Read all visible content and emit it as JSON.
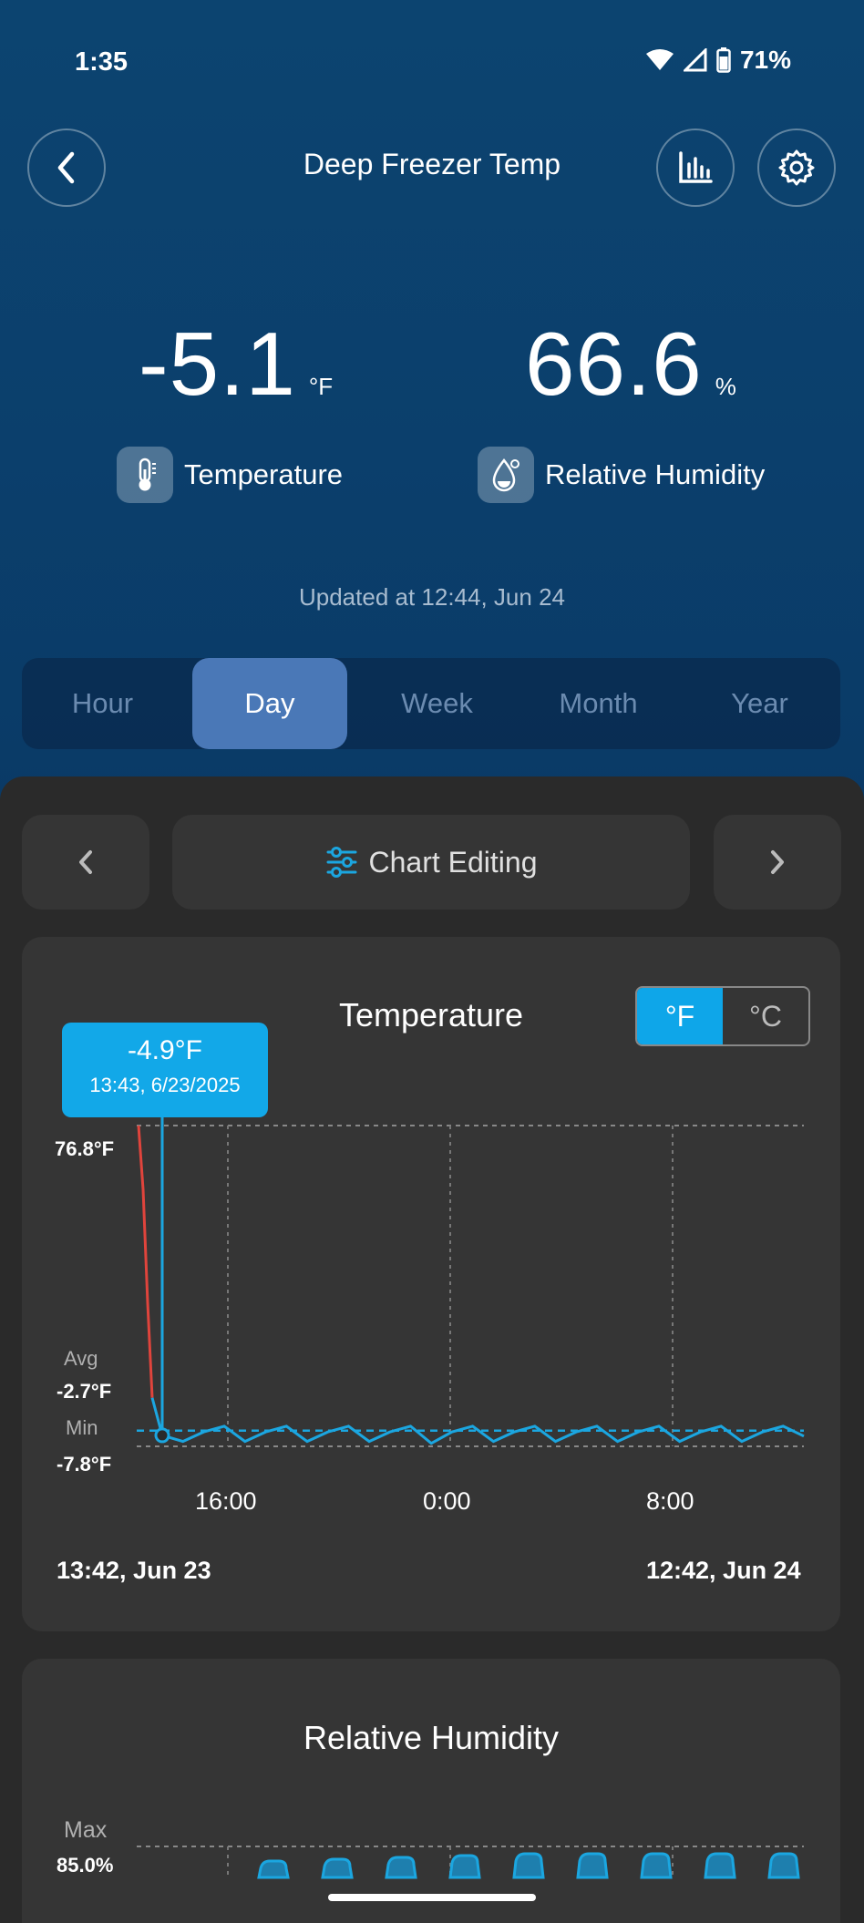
{
  "status": {
    "time": "1:35",
    "battery": "71%"
  },
  "nav": {
    "title": "Deep Freezer Temp",
    "back_icon": "chevron-left-icon",
    "chart_icon": "bar-chart-icon",
    "settings_icon": "gear-icon"
  },
  "readings": {
    "temperature": {
      "value": "-5.1",
      "unit": "°F",
      "label": "Temperature"
    },
    "humidity": {
      "value": "66.6",
      "unit": "%",
      "label": "Relative Humidity"
    }
  },
  "updated": "Updated at 12:44, Jun 24",
  "range_tabs": [
    {
      "label": "Hour"
    },
    {
      "label": "Day"
    },
    {
      "label": "Week"
    },
    {
      "label": "Month"
    },
    {
      "label": "Year"
    }
  ],
  "range_selected": "Day",
  "chart_nav": {
    "edit_label": "Chart Editing"
  },
  "temp_card": {
    "title": "Temperature",
    "unit_f": "°F",
    "unit_c": "°C",
    "tooltip_value": "-4.9°F",
    "tooltip_time": "13:43, 6/23/2025",
    "max_value": "76.8°F",
    "avg_label": "Avg",
    "avg_value": "-2.7°F",
    "min_label": "Min",
    "min_value": "-7.8°F",
    "ticks": [
      "16:00",
      "0:00",
      "8:00"
    ],
    "start_label": "13:42, Jun 23",
    "end_label": "12:42, Jun 24"
  },
  "humidity_card": {
    "title": "Relative Humidity",
    "max_label": "Max",
    "max_value": "85.0%"
  },
  "colors": {
    "accent": "#0ea6e9",
    "series": "#1ba6e0",
    "spike": "#e0443c",
    "tab_active": "#4a78b7"
  },
  "chart_data": [
    {
      "type": "line",
      "title": "Temperature",
      "ylabel": "°F",
      "x_ticks": [
        "16:00",
        "0:00",
        "8:00"
      ],
      "ylim": [
        -7.8,
        76.8
      ],
      "reference_lines": {
        "max": 76.8,
        "avg": -2.7,
        "min": -7.8
      },
      "series": [
        {
          "values": [
            76.8,
            60,
            30,
            5,
            -4.9,
            -6.5,
            -4.0,
            -2.5,
            -6.5,
            -4.0,
            -2.5,
            -6.5,
            -4.0,
            -2.5,
            -6.5,
            -4.0,
            -2.5,
            -7.0,
            -4.0,
            -2.5,
            -6.5,
            -4.0,
            -2.5,
            -6.5,
            -4.0,
            -2.5,
            -6.5,
            -4.0,
            -2.5,
            -6.5,
            -4.0,
            -2.5,
            -6.5,
            -4.0,
            -2.5,
            -5.1
          ]
        }
      ]
    },
    {
      "type": "area",
      "title": "Relative Humidity",
      "ylabel": "%",
      "series": [
        {
          "values": [
            85,
            85,
            85,
            85,
            85,
            85,
            85,
            85,
            85
          ]
        }
      ]
    }
  ]
}
